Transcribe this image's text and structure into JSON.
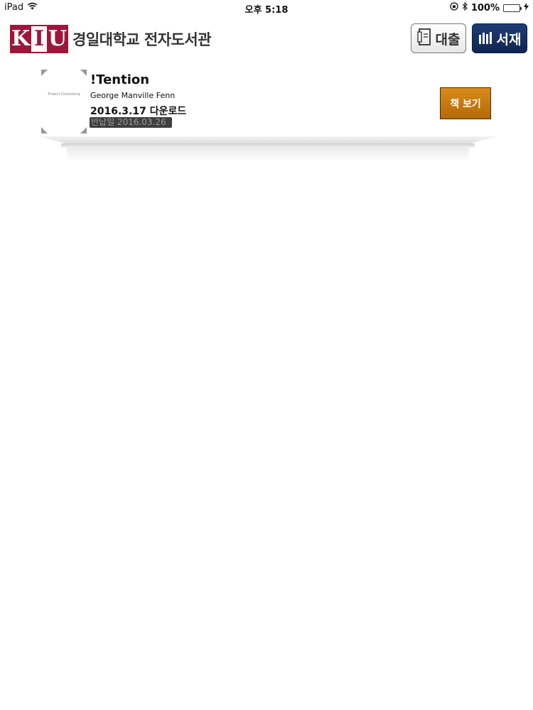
{
  "status_bar": {
    "device": "iPad",
    "time": "오후 5:18",
    "battery": "100%",
    "battery_level": 1.0
  },
  "header": {
    "logo_letters": [
      "K",
      "I",
      "U"
    ],
    "logo_text": "경일대학교 전자도서관",
    "loan_label": "대출",
    "shelf_label": "서재"
  },
  "books": [
    {
      "title": "!Tention",
      "author": "George Manville Fenn",
      "downloaded": "2016.3.17 다운로드",
      "due": "반납일 2016.03.26",
      "cover_text": "Project Gutenberg",
      "view_label": "책 보기"
    }
  ],
  "colors": {
    "brand": "#a0163a",
    "shelf_button": "#1d3e74",
    "view_button": "#c87a10"
  }
}
